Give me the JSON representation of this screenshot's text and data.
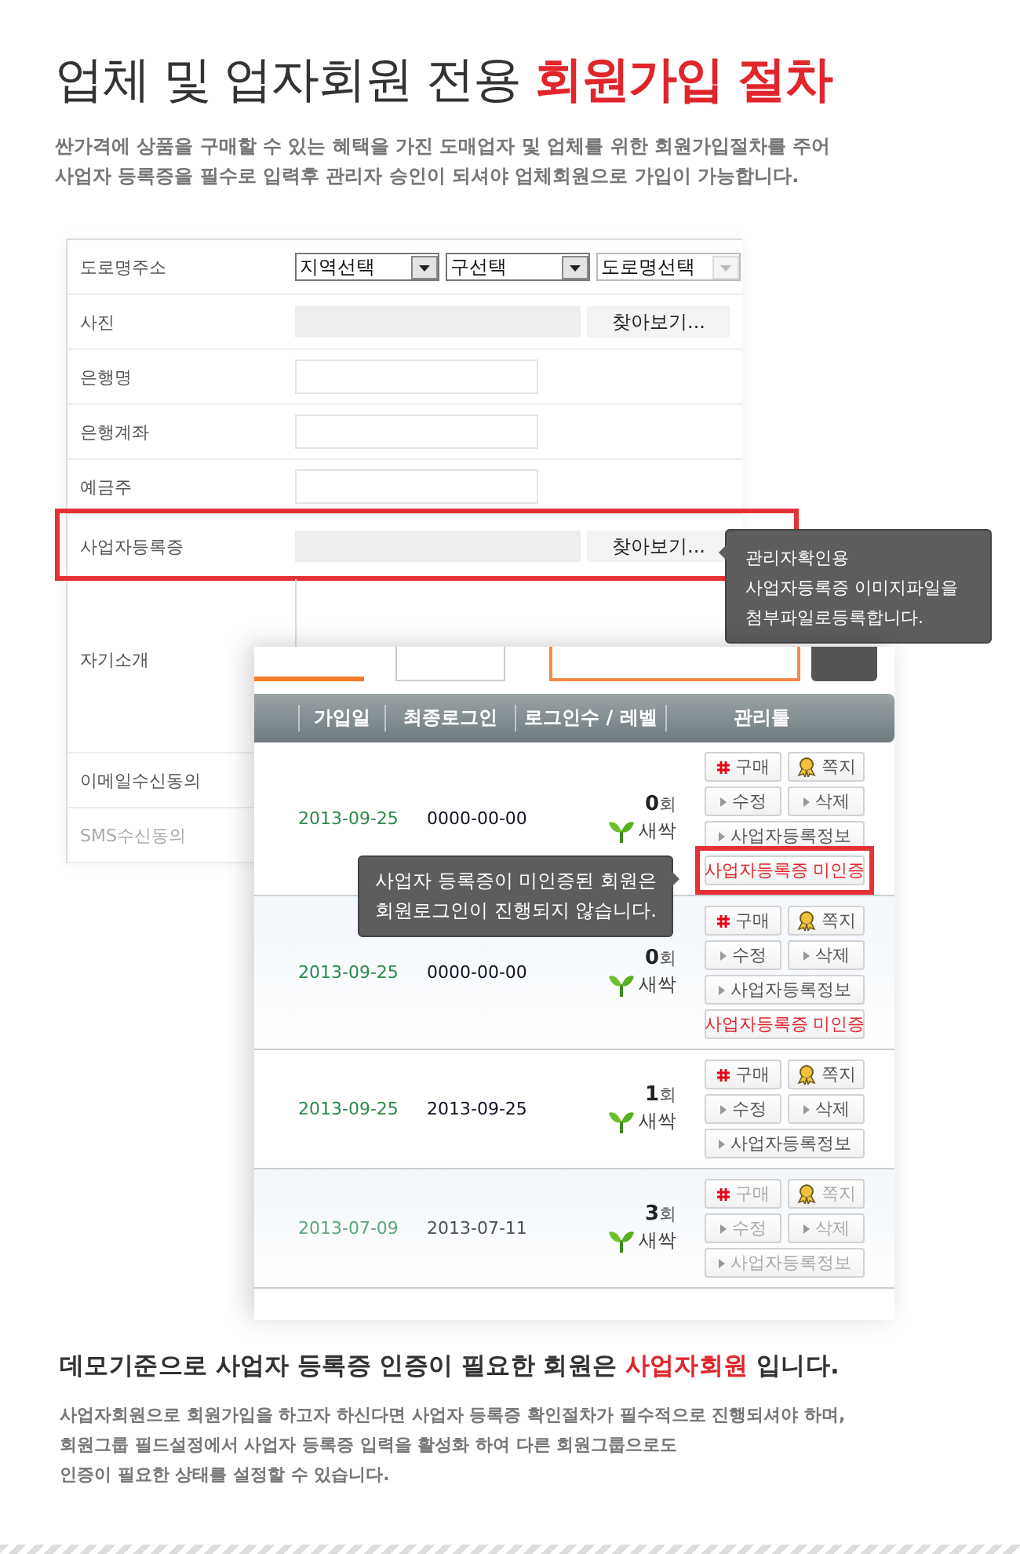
{
  "title": "업체 및 업자회원 전용 **회원가입 절차**",
  "intro": "싼가격에 상품을 구매할 수 있는 혜택을 가진 도매업자 및 업체를 위한 회원가입절차를 주어\n사업자 등록증을 필수로 입력후 관리자 승인이 되셔야 업체회원으로 가입이 가능합니다.",
  "form": {
    "rows": [
      {
        "kind": "selects",
        "label": "도로명주소",
        "highlighted": false,
        "faded": false,
        "selects": [
          {
            "value": "지역선택",
            "disabled": false
          },
          {
            "value": "구선택",
            "disabled": false
          },
          {
            "value": "도로명선택",
            "disabled": true
          }
        ]
      },
      {
        "kind": "file",
        "label": "사진",
        "button": "찾아보기...",
        "highlighted": false,
        "faded": false
      },
      {
        "kind": "text",
        "label": "은행명",
        "highlighted": false,
        "faded": false
      },
      {
        "kind": "text",
        "label": "은행계좌",
        "highlighted": false,
        "faded": false
      },
      {
        "kind": "text",
        "label": "예금주",
        "highlighted": false,
        "faded": false
      },
      {
        "kind": "file",
        "label": "사업자등록증",
        "button": "찾아보기...",
        "highlighted": true,
        "faded": false
      },
      {
        "kind": "textarea",
        "label": "자기소개",
        "highlighted": false,
        "faded": false
      },
      {
        "kind": "plain",
        "label": "이메일수신동의",
        "highlighted": false,
        "faded": false
      },
      {
        "kind": "plain",
        "label": "SMS수신동의",
        "highlighted": false,
        "faded": true
      }
    ],
    "tooltip": "관리자확인용\n사업자등록증 이미지파일을\n첨부파일로등록합니다."
  },
  "member_table": {
    "columns": [
      "가입일",
      "최종로그인",
      "로그인수 / 레벨",
      "관리툴"
    ],
    "rows": [
      {
        "joined": "2013-09-25",
        "last_login": "0000-00-00",
        "login_count": "0",
        "count_unit": "회",
        "level": "새싹",
        "shaded": false,
        "faded": false,
        "highlighted": true,
        "actions": {
          "buy": "구매",
          "note": "쪽지",
          "edit": "수정",
          "delete": "삭제",
          "info": "사업자등록정보",
          "unverified": "사업자등록증 미인증"
        }
      },
      {
        "joined": "2013-09-25",
        "last_login": "0000-00-00",
        "login_count": "0",
        "count_unit": "회",
        "level": "새싹",
        "shaded": true,
        "faded": false,
        "highlighted": false,
        "actions": {
          "buy": "구매",
          "note": "쪽지",
          "edit": "수정",
          "delete": "삭제",
          "info": "사업자등록정보",
          "unverified": "사업자등록증 미인증"
        }
      },
      {
        "joined": "2013-09-25",
        "last_login": "2013-09-25",
        "login_count": "1",
        "count_unit": "회",
        "level": "새싹",
        "shaded": false,
        "faded": false,
        "actions": {
          "buy": "구매",
          "note": "쪽지",
          "edit": "수정",
          "delete": "삭제",
          "info": "사업자등록정보"
        }
      },
      {
        "joined": "2013-07-09",
        "last_login": "2013-07-11",
        "login_count": "3",
        "count_unit": "회",
        "level": "새싹",
        "shaded": true,
        "faded": true,
        "actions": {
          "buy": "구매",
          "note": "쪽지",
          "edit": "수정",
          "delete": "삭제",
          "info": "사업자등록정보"
        }
      }
    ],
    "tooltip": "사업자 등록증이 미인증된 회원은\n회원로그인이 진행되지 않습니다."
  },
  "summary": {
    "heading": "데모기준으로 사업자 등록증 인증이 필요한 회원은 **사업자회원** 입니다.",
    "body": "사업자회원으로 회원가입을 하고자 하신다면 사업자 등록증 확인절차가 필수적으로 진행되셔야 하며,\n회원그룹 필드설정에서 사업자 등록증 입력을 활성화 하여 다른 회원그룹으로도\n인증이 필요한 상태를 설정할 수 있습니다."
  }
}
